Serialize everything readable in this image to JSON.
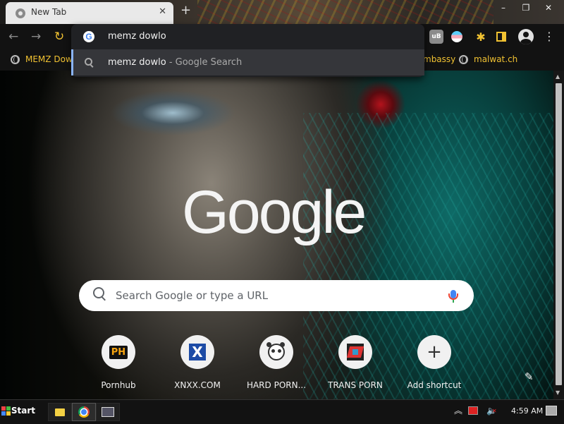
{
  "browser": {
    "tab_title": "New Tab",
    "tab_close": "✕",
    "new_tab": "+",
    "window_controls": {
      "minimize": "–",
      "restore": "❐",
      "close": "✕"
    }
  },
  "toolbar": {
    "back_icon": "←",
    "forward_icon": "→",
    "reload_icon": "↻",
    "extensions": {
      "ublock": "uB",
      "puzzle": "✱",
      "menu": "⋮"
    }
  },
  "omnibox": {
    "input_value": "memz dowlo",
    "suggestion_text": "memz dowlo",
    "suggestion_sep": " - ",
    "suggestion_desc": "Google Search"
  },
  "bookmarks": [
    {
      "label": "MEMZ Down"
    },
    {
      "label": "mbassy"
    },
    {
      "label": "malwat.ch"
    }
  ],
  "ntp": {
    "logo": "Google",
    "search_placeholder": "Search Google or type a URL",
    "shortcuts": [
      {
        "label": "Pornhub",
        "icon": "PH"
      },
      {
        "label": "XNXX.COM",
        "icon": "X"
      },
      {
        "label": "HARD PORN...",
        "icon": "panda"
      },
      {
        "label": "TRANS PORN",
        "icon": "trans"
      },
      {
        "label": "Add shortcut",
        "icon": "+"
      }
    ],
    "edit_icon": "✎"
  },
  "taskbar": {
    "start_label": "Start",
    "clock": "4:59 AM",
    "tray_chevron": "︽",
    "volume_icon": "🔈"
  },
  "colors": {
    "bookmark_text": "#f1c232",
    "omni_highlight": "#35363a",
    "accent_blue": "#8ab4f8"
  }
}
